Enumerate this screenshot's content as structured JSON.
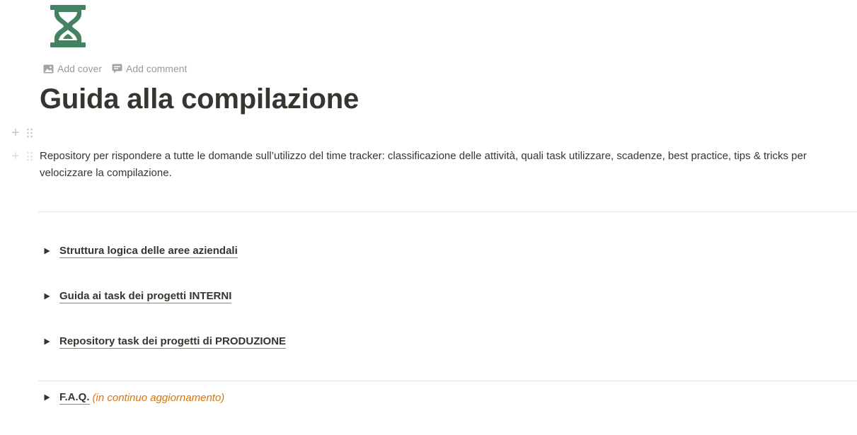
{
  "page": {
    "icon": "hourglass-icon",
    "icon_color": "#448361",
    "title": "Guida alla compilazione",
    "description": "Repository per rispondere a tutte le domande sull’utilizzo del time tracker: classificazione delle attività, quali task utilizzare, scadenze, best practice, tips & tricks per velocizzare la compilazione."
  },
  "controls": {
    "add_cover": "Add cover",
    "add_comment": "Add comment"
  },
  "toggles": [
    {
      "label": "Struttura logica delle aree aziendali"
    },
    {
      "label": "Guida ai task dei progetti INTERNI"
    },
    {
      "label": "Repository task dei progetti di PRODUZIONE"
    },
    {
      "label": "F.A.Q.",
      "note": "(in continuo aggiornamento)"
    }
  ],
  "colors": {
    "text": "#37352f",
    "muted": "#9b9a97",
    "accent_orange": "#d9730d",
    "divider": "#e3e2e0"
  }
}
